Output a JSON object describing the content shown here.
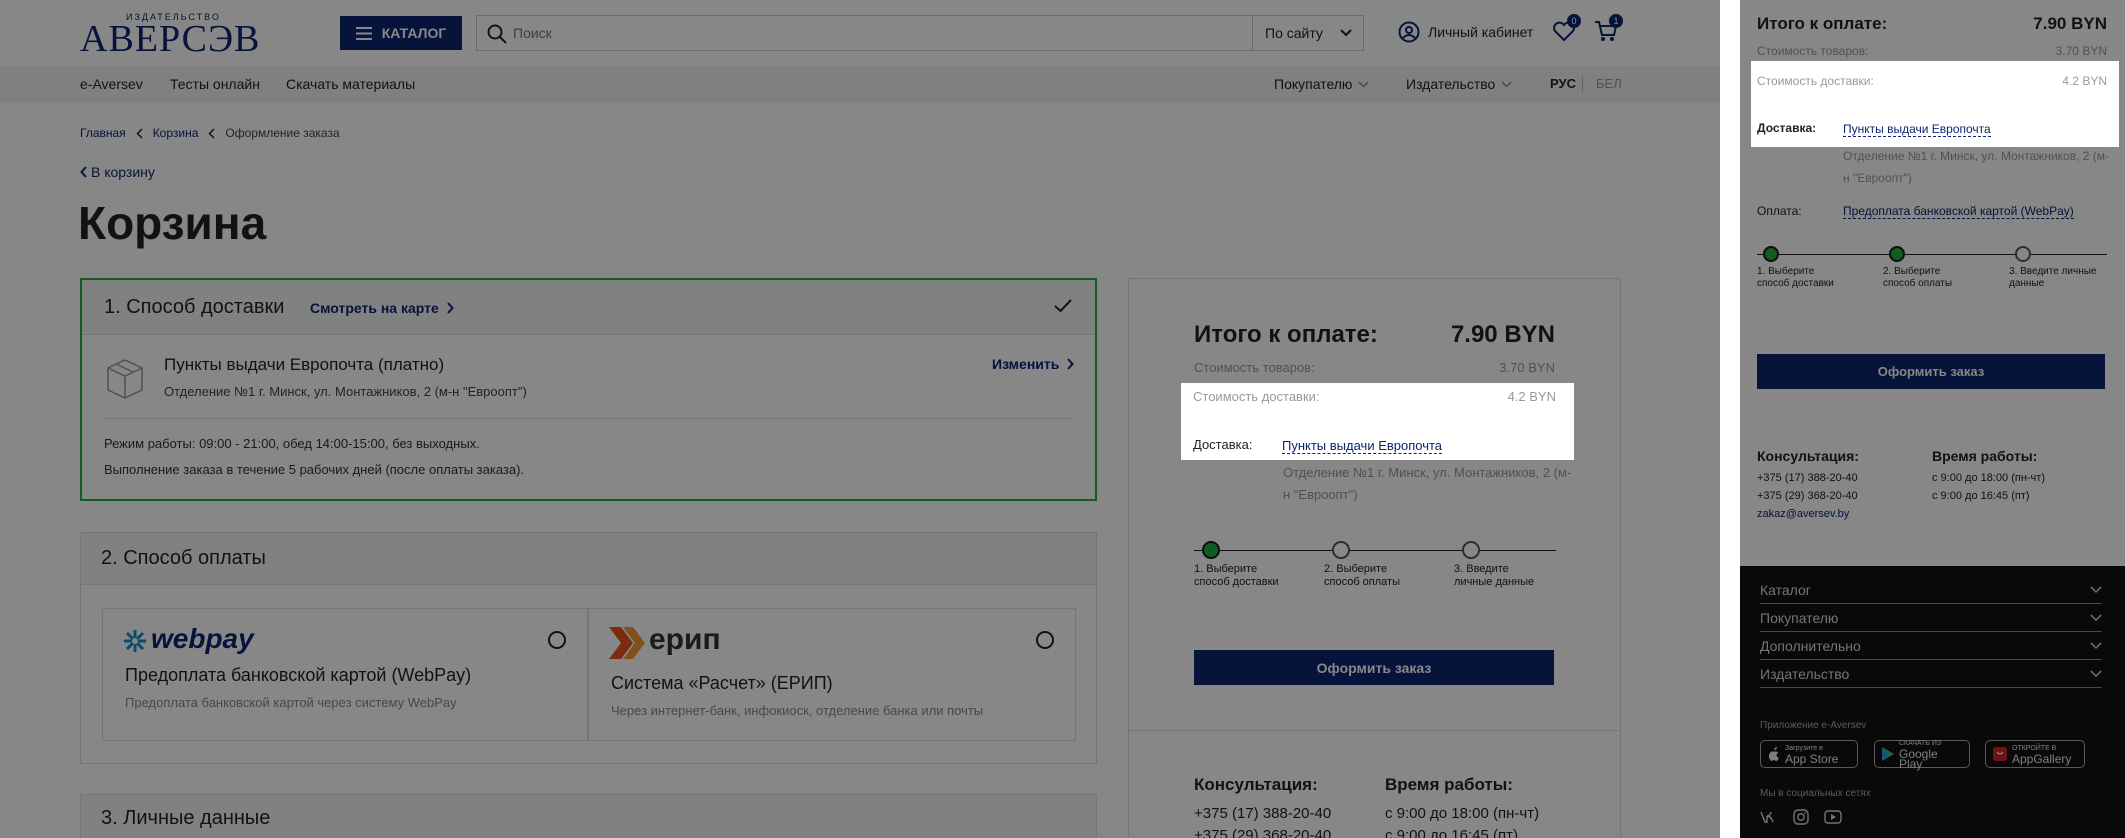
{
  "header": {
    "logo_small": "ИЗДАТЕЛЬСТВО",
    "logo_main": "АВЕРСЭВ",
    "catalog_label": "КАТАЛОГ",
    "search_placeholder": "Поиск",
    "search_scope": "По сайту",
    "account_label": "Личный кабинет",
    "favorites_count": "0",
    "cart_count": "1"
  },
  "subnav": {
    "items": [
      "e-Aversev",
      "Тесты онлайн",
      "Скачать материалы"
    ],
    "buyer": "Покупателю",
    "publisher": "Издательство",
    "lang_active": "РУС",
    "lang_other": "БЕЛ"
  },
  "breadcrumb": [
    "Главная",
    "Корзина",
    "Оформление заказа"
  ],
  "back_link": "В корзину",
  "page_title": "Корзина",
  "delivery": {
    "title": "1. Способ доставки",
    "map_link": "Смотреть на карте",
    "option_title": "Пункты выдачи Европочта (платно)",
    "option_address": "Отделение №1 г. Минск, ул. Монтажников, 2 (м-н \"Евроопт\")",
    "change": "Изменить",
    "hours": "Режим работы: 09:00 - 21:00, обед 14:00-15:00, без выходных.",
    "fulfillment": "Выполнение заказа в течение 5 рабочих дней (после оплаты заказа)."
  },
  "payment": {
    "title": "2. Способ оплаты",
    "options": [
      {
        "logo": "webpay",
        "title": "Предоплата банковской картой (WebPay)",
        "desc": "Предоплата банковской картой через систему WebPay"
      },
      {
        "logo": "ерип",
        "title": "Система «Расчет» (ЕРИП)",
        "desc": "Через интернет-банк, инфокиоск, отделение банка или почты"
      }
    ]
  },
  "personal": {
    "title": "3. Личные данные"
  },
  "summary": {
    "total_label": "Итого к оплате:",
    "total_value": "7.90 BYN",
    "goods_label": "Стоимость товаров:",
    "goods_value": "3.70 BYN",
    "delivery_cost_label": "Стоимость доставки:",
    "delivery_cost_value": "4.2 BYN",
    "delivery_label": "Доставка:",
    "delivery_value": "Пункты выдачи Европочта",
    "delivery_address": "Отделение №1 г. Минск, ул. Монтажников, 2 (м-н \"Евроопт\")",
    "payment_label": "Оплата:",
    "payment_value": "Предоплата банковской картой (WebPay)",
    "steps": [
      "1. Выберите способ доставки",
      "2. Выберите способ оплаты",
      "3. Введите личные данные"
    ],
    "order_button": "Оформить заказ"
  },
  "contacts": {
    "consult_title": "Консультация:",
    "phone1": "+375 (17) 388-20-40",
    "phone2": "+375 (29) 368-20-40",
    "email": "zakaz@aversev.by",
    "hours_title": "Время работы:",
    "hours1": "с 9:00 до 18:00 (пн-чт)",
    "hours2": "с 9:00 до 16:45 (пт)"
  },
  "footer": {
    "rows": [
      "Каталог",
      "Покупателю",
      "Дополнительно",
      "Издательство"
    ],
    "app_label": "Приложение e-Aversev",
    "stores": [
      {
        "small": "Загрузите в",
        "big": "App Store"
      },
      {
        "small": "СКАЧАТЬ ИЗ",
        "big": "Google Play"
      },
      {
        "small": "ОТКРОЙТЕ В",
        "big": "AppGallery"
      }
    ],
    "social_label": "Мы в социальных сетях"
  },
  "colors": {
    "brand": "#0d2470",
    "success": "#1fae3f",
    "overlay": "rgba(0,0,0,0.47)",
    "footer_bg": "#111111"
  }
}
